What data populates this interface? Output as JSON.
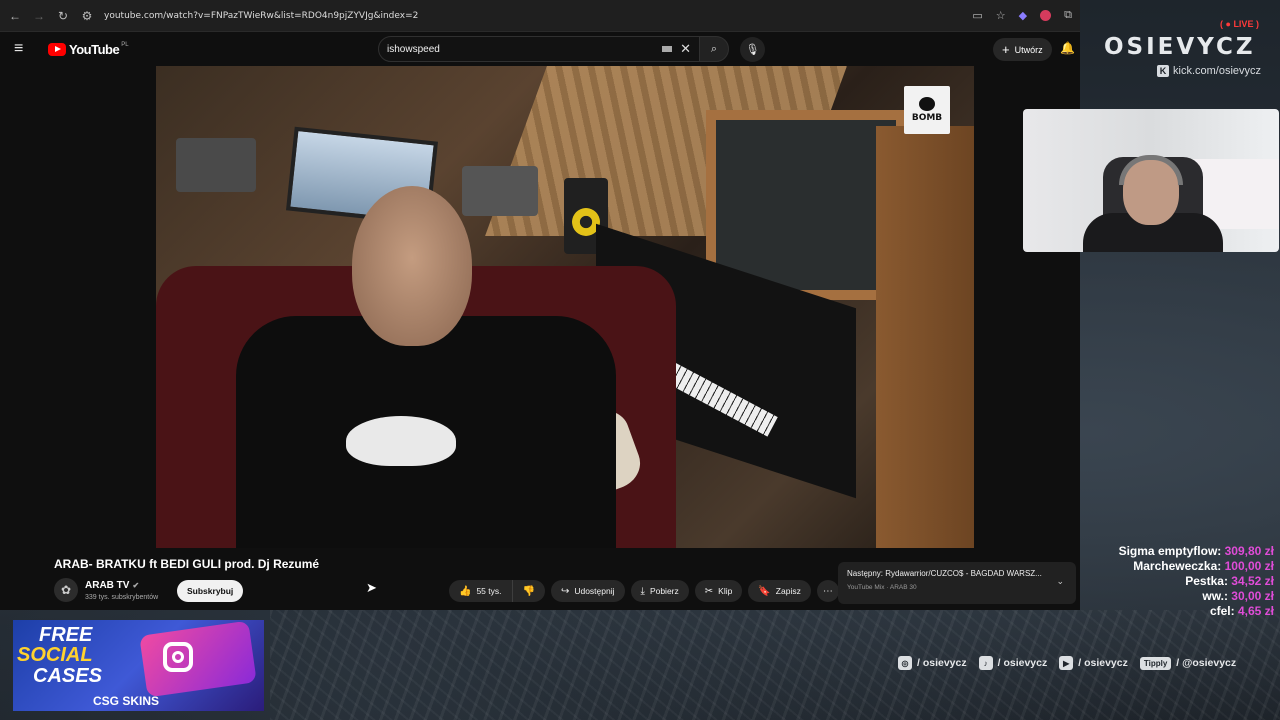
{
  "browser": {
    "url": "youtube.com/watch?v=FNPazTWieRw&list=RDO4n9pjZYVJg&index=2"
  },
  "youtube": {
    "logo_text": "YouTube",
    "logo_country": "PL",
    "search_value": "ishowspeed",
    "create_label": "Utwórz"
  },
  "video": {
    "badge_text": "BOMB",
    "title": "ARAB- BRATKU ft BEDI GULI prod. Dj Rezumé",
    "channel_name": "ARAB TV",
    "subscribers": "339 tys. subskrybentów",
    "subscribe_label": "Subskrybuj",
    "likes": "55 tys.",
    "share_label": "Udostępnij",
    "download_label": "Pobierz",
    "clip_label": "Klip",
    "save_label": "Zapisz"
  },
  "next_up": {
    "line1": "Następny: Rydawarrior/CUZCO$ - BAGDAD WARSZ...",
    "line2": "YouTube Mix · ARAB 30"
  },
  "overlay": {
    "brand": "OSIEVYCZ",
    "live": "LIVE",
    "kick_handle": "kick.com/osievycz",
    "donations": [
      {
        "name": "Sigma emptyflow:",
        "amount": "309,80 zł"
      },
      {
        "name": "Marcheweczka:",
        "amount": "100,00 zł"
      },
      {
        "name": "Pestka:",
        "amount": "34,52 zł"
      },
      {
        "name": "ww.:",
        "amount": "30,00 zł"
      },
      {
        "name": "cfel:",
        "amount": "4,65 zł"
      }
    ],
    "ad": {
      "line1": "FREE",
      "line2": "SOCIAL",
      "line3": "CASES",
      "brand": "CSG SKINS"
    },
    "socials": {
      "instagram": "/ osievycz",
      "tiktok": "/ osievycz",
      "youtube": "/ osievycz",
      "tipply_badge": "Tipply",
      "tipply": "/ @osievycz"
    }
  },
  "colors": {
    "youtube_red": "#ff0000",
    "donation_amount": "#e04cd8",
    "live_red": "#ff3a3a"
  }
}
